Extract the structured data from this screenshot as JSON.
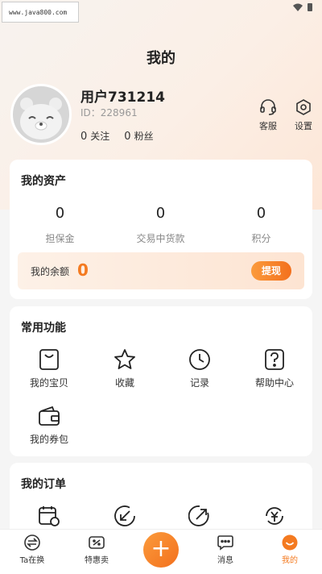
{
  "watermark": "www.java800.com",
  "header": {
    "title": "我的"
  },
  "profile": {
    "name": "用户731214",
    "id_label": "ID：228961",
    "follow_count": "0",
    "follow_label": "关注",
    "fans_count": "0",
    "fans_label": "粉丝",
    "service_label": "客服",
    "settings_label": "设置"
  },
  "assets": {
    "title": "我的资产",
    "items": [
      {
        "value": "0",
        "label": "担保金"
      },
      {
        "value": "0",
        "label": "交易中货款"
      },
      {
        "value": "0",
        "label": "积分"
      }
    ],
    "balance_label": "我的余额",
    "balance_value": "0",
    "withdraw_label": "提现"
  },
  "functions": {
    "title": "常用功能",
    "items": [
      {
        "label": "我的宝贝",
        "icon": "bag-icon"
      },
      {
        "label": "收藏",
        "icon": "star-icon"
      },
      {
        "label": "记录",
        "icon": "clock-icon"
      },
      {
        "label": "帮助中心",
        "icon": "help-icon"
      },
      {
        "label": "我的券包",
        "icon": "wallet-icon"
      }
    ]
  },
  "orders": {
    "title": "我的订单",
    "icons": [
      "calendar-icon",
      "arrow-down-left-icon",
      "arrow-up-right-icon",
      "refund-icon"
    ]
  },
  "tabbar": {
    "items": [
      {
        "label": "Ta在换",
        "icon": "swap-icon"
      },
      {
        "label": "特惠卖",
        "icon": "discount-icon"
      },
      {
        "label": "消息",
        "icon": "message-icon"
      },
      {
        "label": "我的",
        "icon": "smile-icon"
      }
    ],
    "active_index": 3,
    "plus_label": "+"
  },
  "colors": {
    "accent": "#f47a20",
    "accent_light": "#fb9b3c"
  }
}
